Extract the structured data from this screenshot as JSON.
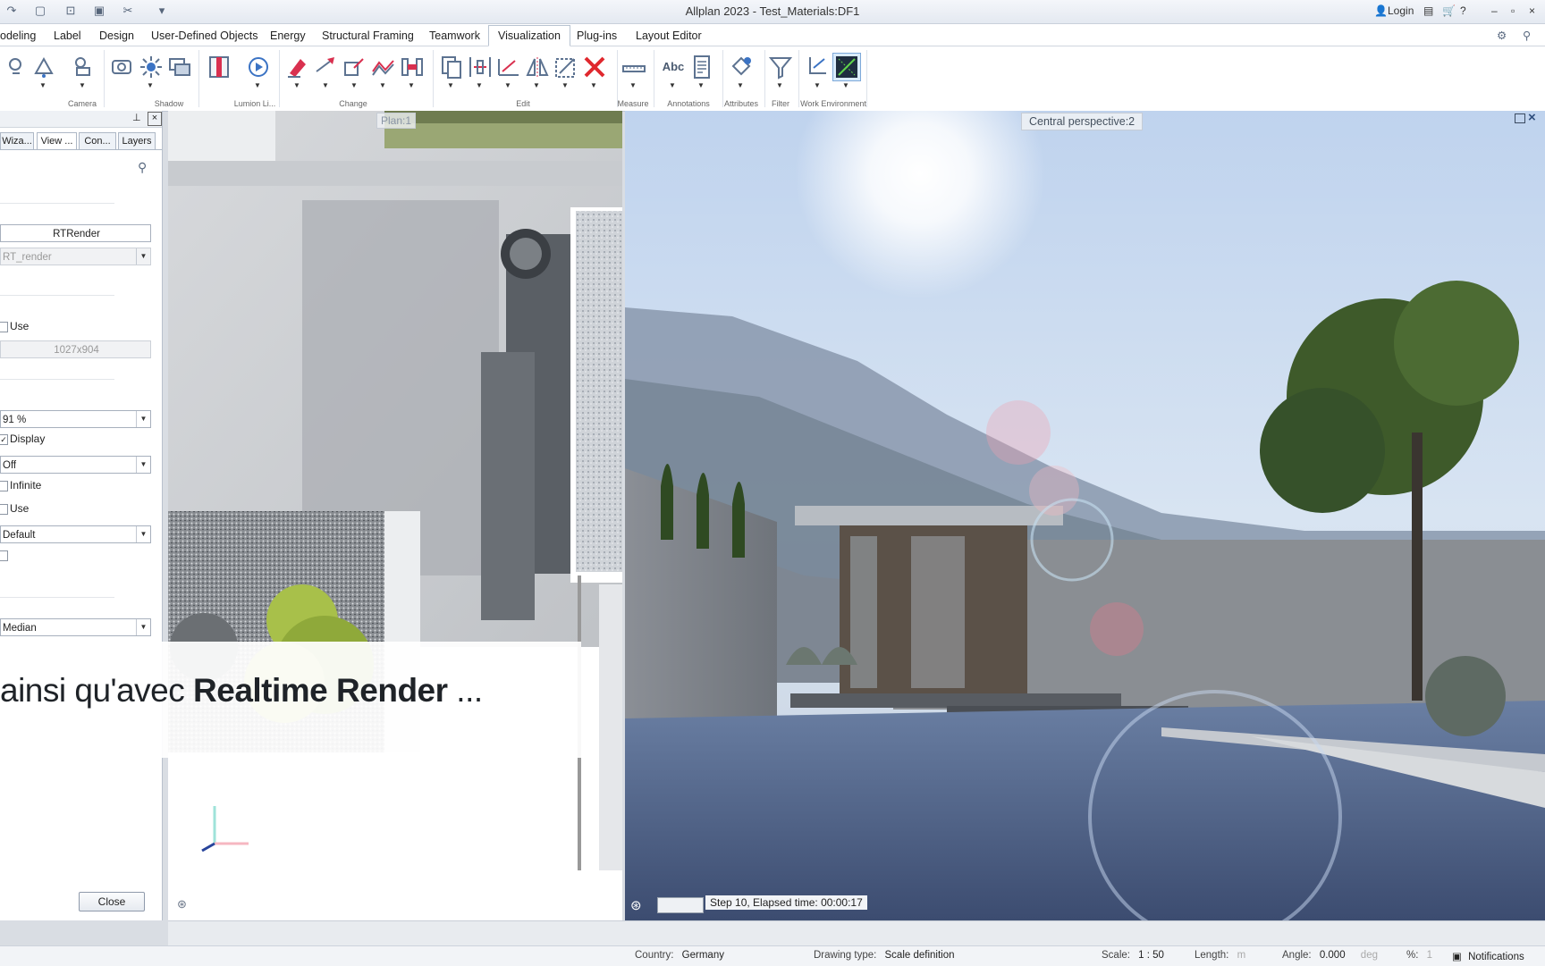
{
  "window": {
    "title": "Allplan 2023 - Test_Materials:DF1",
    "login_label": "Login"
  },
  "ribbon_tabs": [
    {
      "label": "odeling",
      "active": false
    },
    {
      "label": "Label",
      "active": false
    },
    {
      "label": "Design",
      "active": false
    },
    {
      "label": "User-Defined Objects",
      "active": false
    },
    {
      "label": "Energy",
      "active": false
    },
    {
      "label": "Structural Framing",
      "active": false
    },
    {
      "label": "Teamwork",
      "active": false
    },
    {
      "label": "Visualization",
      "active": true
    },
    {
      "label": "Plug-ins",
      "active": false
    },
    {
      "label": "Layout Editor",
      "active": false
    }
  ],
  "ribbon_groups": {
    "camera": "Camera",
    "shadow": "Shadow",
    "lumion": "Lumion Li...",
    "change": "Change",
    "edit": "Edit",
    "measure": "Measure",
    "annotations": "Annotations",
    "attributes": "Attributes",
    "filter": "Filter",
    "work_environment": "Work Environment"
  },
  "ribbon_text_icon": "Abc",
  "palette": {
    "tabs": [
      "Wiza...",
      "View ...",
      "Con...",
      "Layers"
    ],
    "active_tab": 1,
    "render_name": "RTRender",
    "render_profile": "RT_render",
    "use_label_1": "Use",
    "resolution": "1027x904",
    "quality": "91 %",
    "display_label": "Display",
    "off_value": "Off",
    "infinite_label": "Infinite",
    "use_label_2": "Use",
    "default_value": "Default",
    "filter_value": "Median",
    "close_label": "Close"
  },
  "caption": {
    "prefix": "ainsi qu'avec ",
    "bold": "Realtime Render",
    "suffix": " ..."
  },
  "plan_view": {
    "label": "Plan:1"
  },
  "perspective_view": {
    "label": "Central perspective:2",
    "progress_text": "Step 10, Elapsed time: 00:00:17"
  },
  "statusbar": {
    "country_label": "Country:",
    "country_value": "Germany",
    "drawing_type_label": "Drawing type:",
    "drawing_type_value": "Scale definition",
    "scale_label": "Scale:",
    "scale_value": "1 : 50",
    "length_label": "Length:",
    "length_unit": "m",
    "angle_label": "Angle:",
    "angle_value": "0.000",
    "angle_unit": "deg",
    "percent_label": "%:",
    "percent_value": "1",
    "notifications_label": "Notifications"
  },
  "colors": {
    "accent": "#3b73c4",
    "delete_red": "#e0282e",
    "edit_pink": "#d9304f"
  }
}
